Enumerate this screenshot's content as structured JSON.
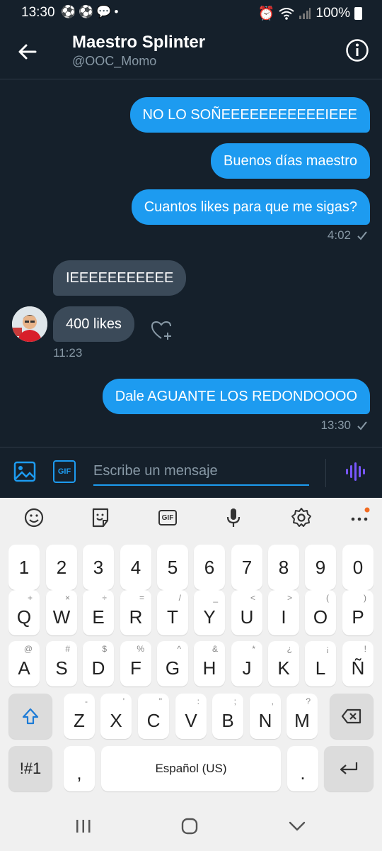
{
  "status": {
    "time": "13:30",
    "battery": "100%"
  },
  "header": {
    "title": "Maestro Splinter",
    "handle": "@OOC_Momo"
  },
  "messages": [
    {
      "text": "NO LO SOÑEEEEEEEEEEEIEEE",
      "direction": "out"
    },
    {
      "text": "Buenos días maestro",
      "direction": "out"
    },
    {
      "text": "Cuantos likes para que me sigas?",
      "direction": "out"
    },
    {
      "text": "IEEEEEEEEEEE",
      "direction": "in"
    },
    {
      "text": "400 likes",
      "direction": "in"
    },
    {
      "text": "Dale AGUANTE LOS REDONDOOOO",
      "direction": "out"
    }
  ],
  "timestamps": {
    "group1": "4:02",
    "group2": "11:23",
    "group3": "13:30"
  },
  "composer": {
    "placeholder": "Escribe un mensaje",
    "gif_label": "GIF"
  },
  "keyboard": {
    "toolbar": [
      "emoji-icon",
      "sticker-icon",
      "gif-icon",
      "microphone-icon",
      "settings-icon",
      "more-icon"
    ],
    "toolbar_gif_label": "GIF",
    "number_row": [
      "1",
      "2",
      "3",
      "4",
      "5",
      "6",
      "7",
      "8",
      "9",
      "0"
    ],
    "row1": [
      "Q",
      "W",
      "E",
      "R",
      "T",
      "Y",
      "U",
      "I",
      "O",
      "P"
    ],
    "row1_hints": [
      "+",
      "×",
      "÷",
      "=",
      "/",
      "_",
      "<",
      ">",
      "(",
      ")"
    ],
    "row2": [
      "A",
      "S",
      "D",
      "F",
      "G",
      "H",
      "J",
      "K",
      "L",
      "Ñ"
    ],
    "row2_hints": [
      "@",
      "#",
      "$",
      "%",
      "^",
      "&",
      "*",
      "¿",
      "¡",
      "!"
    ],
    "row3": [
      "Z",
      "X",
      "C",
      "V",
      "B",
      "N",
      "M"
    ],
    "row3_hints": [
      "-",
      "'",
      "\"",
      ":",
      ";",
      ",",
      "?"
    ],
    "symbols_label": "!#1",
    "comma": ",",
    "space_label": "Español (US)",
    "period": "."
  },
  "colors": {
    "background": "#15202b",
    "accent": "#1d9bf0",
    "incoming": "#3b4a59"
  }
}
